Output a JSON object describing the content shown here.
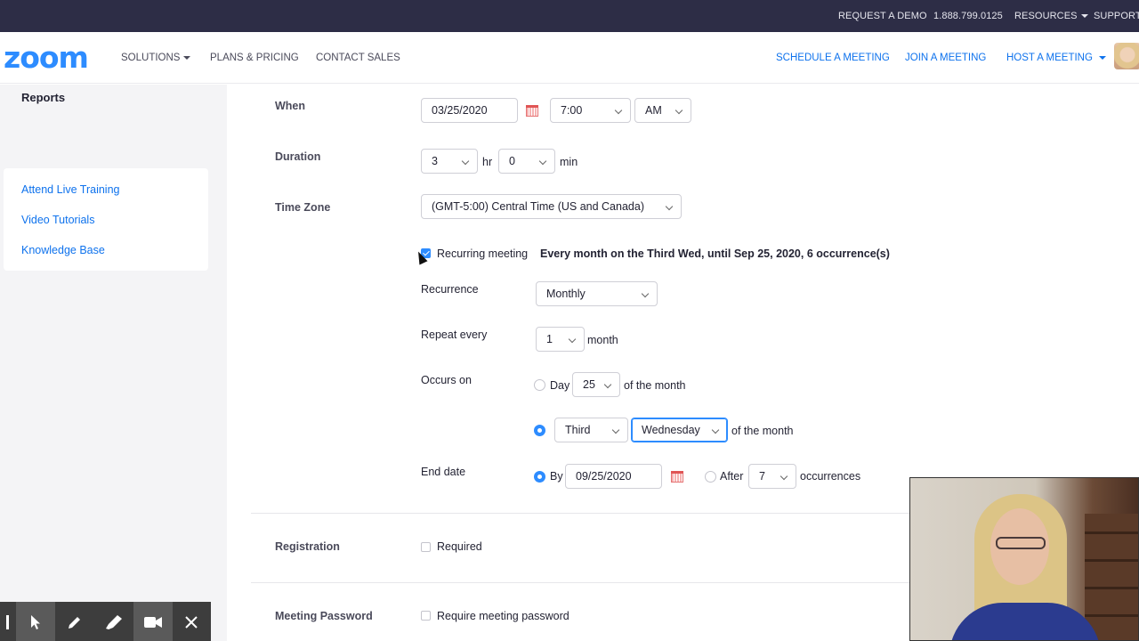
{
  "topbar": {
    "request_demo": "REQUEST A DEMO",
    "phone": "1.888.799.0125",
    "resources": "RESOURCES",
    "support": "SUPPORT"
  },
  "nav": {
    "logo": "zoom",
    "solutions": "SOLUTIONS",
    "plans": "PLANS & PRICING",
    "contact": "CONTACT SALES",
    "schedule": "SCHEDULE A MEETING",
    "join": "JOIN A MEETING",
    "host": "HOST A MEETING"
  },
  "sidebar": {
    "reports": "Reports",
    "help": [
      "Attend Live Training",
      "Video Tutorials",
      "Knowledge Base"
    ]
  },
  "form": {
    "when": {
      "label": "When",
      "date": "03/25/2020",
      "time": "7:00",
      "ampm": "AM"
    },
    "duration": {
      "label": "Duration",
      "hours": "3",
      "hr_unit": "hr",
      "minutes": "0",
      "min_unit": "min"
    },
    "timezone": {
      "label": "Time Zone",
      "value": "(GMT-5:00) Central Time (US and Canada)"
    },
    "recurring": {
      "checked": true,
      "label": "Recurring meeting",
      "summary": "Every month on the Third Wed, until Sep 25, 2020, 6 occurrence(s)"
    },
    "recurrence": {
      "label": "Recurrence",
      "value": "Monthly"
    },
    "repeat": {
      "label": "Repeat every",
      "value": "1",
      "unit": "month"
    },
    "occurs": {
      "label": "Occurs on",
      "day_label": "Day",
      "day_value": "25",
      "of_month_1": "of the month",
      "week_value": "Third",
      "weekday_value": "Wednesday",
      "of_month_2": "of the month",
      "selected": "week"
    },
    "end_date": {
      "label": "End date",
      "by_label": "By",
      "by_date": "09/25/2020",
      "after_label": "After",
      "after_value": "7",
      "occ_label": "occurrences",
      "selected": "by"
    },
    "registration": {
      "label": "Registration",
      "option": "Required"
    },
    "password": {
      "label": "Meeting Password",
      "option": "Require meeting password"
    }
  },
  "colors": {
    "brand": "#2d8cff",
    "link": "#0e72ed",
    "topbar": "#2d2d46"
  },
  "icons": {
    "calendar": "calendar-icon",
    "pointer": "pointer-icon",
    "pen": "pen-icon",
    "highlighter": "highlighter-icon",
    "camera": "video-camera-icon",
    "close": "close-icon"
  }
}
